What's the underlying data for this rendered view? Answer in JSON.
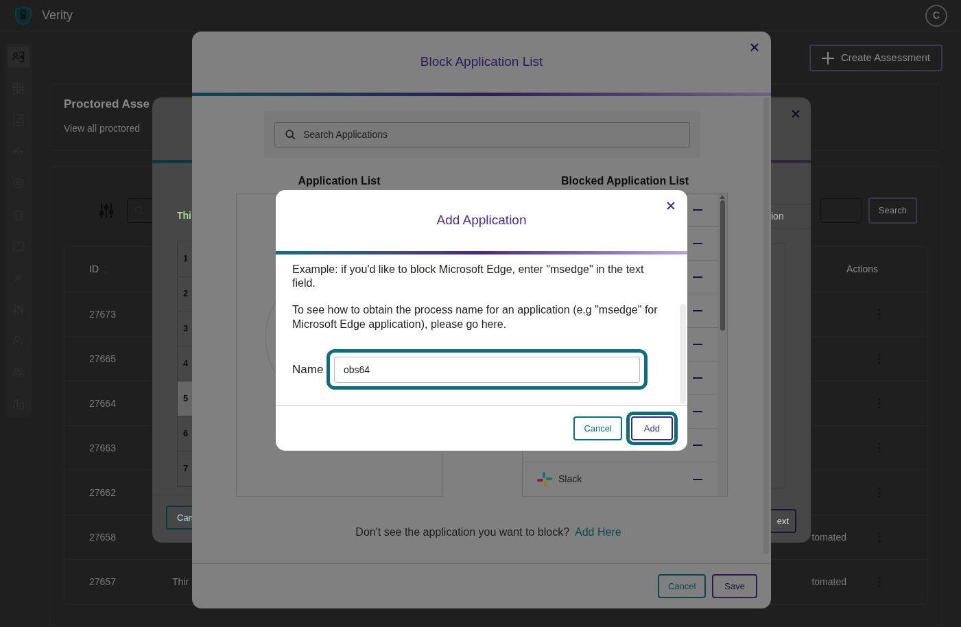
{
  "app": {
    "name": "Verity",
    "avatar": "C",
    "create_button": "Create Assessment"
  },
  "sidebar": {
    "items": [
      {
        "selected": true
      },
      {
        "selected": false
      },
      {
        "selected": false
      },
      {
        "selected": false
      },
      {
        "selected": false
      },
      {
        "selected": false
      },
      {
        "selected": false
      },
      {
        "selected": false
      },
      {
        "selected": false
      },
      {
        "selected": false
      },
      {
        "selected": false
      },
      {
        "selected": false
      }
    ]
  },
  "page": {
    "title": "Proctored Asse",
    "subtitle": "View all proctored",
    "search_button": "Search",
    "table": {
      "columns": [
        "ID",
        "Actions"
      ],
      "rows": [
        {
          "id": "27673"
        },
        {
          "id": "27665"
        },
        {
          "id": "27664"
        },
        {
          "id": "27663"
        },
        {
          "id": "27662"
        },
        {
          "id": "27658",
          "column_3": "tomated"
        },
        {
          "id": "27657",
          "column_2": "Thir",
          "column_3": "tomated"
        }
      ]
    }
  },
  "wizard_dialog": {
    "notice": "Thi",
    "search_placeholder": "ion",
    "steps": [
      {
        "number": "1",
        "selected": false
      },
      {
        "number": "2",
        "selected": false
      },
      {
        "number": "3",
        "selected": false
      },
      {
        "number": "4",
        "selected": false
      },
      {
        "number": "5",
        "selected": true
      },
      {
        "number": "6",
        "selected": false
      },
      {
        "number": "7",
        "selected": false
      }
    ],
    "back_button": "Can",
    "next_button": "ext"
  },
  "block_dialog": {
    "title": "Block Application List",
    "search_placeholder": "Search Applications",
    "application_list_title": "Application List",
    "blocked_list_title": "Blocked Application List",
    "blocked_apps": [
      {
        "name": "Slack"
      }
    ],
    "prompt": "Don't see the application you want to block?",
    "prompt_link": "Add Here",
    "cancel_button": "Cancel",
    "save_button": "Save"
  },
  "add_dialog": {
    "title": "Add Application",
    "example": "Example: if you'd like to block Microsoft Edge, enter \"msedge\" in the text field.",
    "help": "To see how to obtain the process name for an application (e.g \"msedge\" for Microsoft Edge application), please go here.",
    "name_label": "Name",
    "name_value": "obs64",
    "cancel_button": "Cancel",
    "add_button": "Add"
  }
}
